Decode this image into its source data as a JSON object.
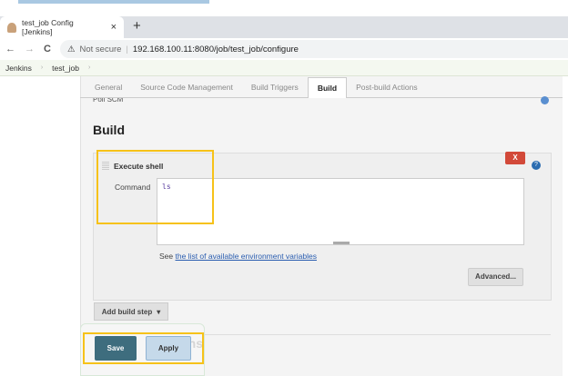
{
  "browser": {
    "tab_title": "test_job Config [Jenkins]",
    "close": "×",
    "new_tab": "+",
    "back": "←",
    "forward": "→",
    "reload": "C",
    "security_icon": "⚠",
    "security_label": "Not secure",
    "url": "192.168.100.11:8080/job/test_job/configure"
  },
  "breadcrumb": {
    "items": [
      "Jenkins",
      "test_job"
    ],
    "sep": "›"
  },
  "config_tabs": [
    {
      "label": "General"
    },
    {
      "label": "Source Code Management"
    },
    {
      "label": "Build Triggers"
    },
    {
      "label": "Build",
      "active": true
    },
    {
      "label": "Post-build Actions"
    }
  ],
  "poll_scm": "Poll SCM",
  "section_title": "Build",
  "step": {
    "title": "Execute shell",
    "delete": "X",
    "help": "?",
    "command_label": "Command",
    "command_value": "ls",
    "see_prefix": "See ",
    "see_link": "the list of available environment variables",
    "advanced": "Advanced..."
  },
  "add_build_step": "Add build step",
  "add_caret": "▾",
  "ghost_heading": "Post-build Actions",
  "save": "Save",
  "apply": "Apply",
  "colors": {
    "highlight": "#f6c219",
    "save": "#3e6d7e",
    "delete": "#d24939"
  }
}
